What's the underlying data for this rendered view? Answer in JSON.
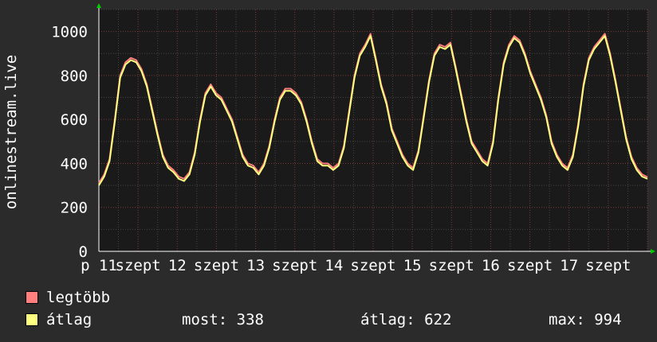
{
  "chart_data": {
    "type": "line",
    "ylabel": "onlinestream.live",
    "ylim": [
      0,
      1100
    ],
    "yticks": [
      0,
      200,
      400,
      600,
      800,
      1000
    ],
    "xlim": [
      0,
      7.0
    ],
    "x_tick_labels": [
      {
        "x": 0.0,
        "label": "p 11"
      },
      {
        "x": 0.5,
        "label": "szept"
      },
      {
        "x": 1.0,
        "label": "12"
      },
      {
        "x": 1.5,
        "label": "szept"
      },
      {
        "x": 2.0,
        "label": "13"
      },
      {
        "x": 2.5,
        "label": "szept"
      },
      {
        "x": 3.0,
        "label": "14"
      },
      {
        "x": 3.5,
        "label": "szept"
      },
      {
        "x": 4.0,
        "label": "15"
      },
      {
        "x": 4.5,
        "label": "szept"
      },
      {
        "x": 5.0,
        "label": "16"
      },
      {
        "x": 5.5,
        "label": "szept"
      },
      {
        "x": 6.0,
        "label": "17"
      },
      {
        "x": 6.5,
        "label": "szept"
      }
    ],
    "grid": true,
    "series": [
      {
        "name": "legtöbb",
        "color": "#ff7f7f",
        "values": [
          310,
          350,
          420,
          600,
          800,
          860,
          880,
          870,
          830,
          760,
          650,
          540,
          440,
          390,
          370,
          340,
          330,
          360,
          450,
          600,
          720,
          760,
          720,
          700,
          650,
          600,
          520,
          440,
          400,
          390,
          360,
          400,
          480,
          600,
          700,
          740,
          740,
          720,
          680,
          600,
          500,
          420,
          400,
          400,
          380,
          400,
          480,
          640,
          800,
          900,
          940,
          990,
          880,
          760,
          680,
          560,
          500,
          440,
          400,
          380,
          460,
          620,
          780,
          900,
          940,
          930,
          950,
          840,
          720,
          600,
          500,
          460,
          420,
          400,
          500,
          700,
          860,
          940,
          980,
          960,
          900,
          820,
          760,
          700,
          620,
          500,
          440,
          400,
          380,
          440,
          580,
          760,
          880,
          930,
          960,
          990,
          900,
          780,
          650,
          520,
          430,
          380,
          350,
          338
        ]
      },
      {
        "name": "átlag",
        "color": "#ffff80",
        "values": [
          300,
          340,
          410,
          590,
          790,
          850,
          870,
          860,
          820,
          750,
          640,
          530,
          430,
          380,
          360,
          330,
          320,
          350,
          440,
          590,
          710,
          750,
          710,
          690,
          640,
          590,
          510,
          430,
          390,
          380,
          350,
          390,
          470,
          590,
          690,
          730,
          730,
          710,
          670,
          590,
          490,
          410,
          390,
          390,
          370,
          390,
          470,
          630,
          790,
          890,
          930,
          980,
          870,
          750,
          670,
          550,
          490,
          430,
          390,
          370,
          450,
          610,
          770,
          890,
          930,
          920,
          940,
          830,
          710,
          590,
          490,
          450,
          410,
          390,
          490,
          690,
          850,
          930,
          970,
          950,
          890,
          810,
          750,
          690,
          610,
          490,
          430,
          390,
          370,
          430,
          570,
          750,
          870,
          920,
          950,
          980,
          890,
          770,
          640,
          510,
          420,
          370,
          340,
          330
        ]
      }
    ],
    "legend": [
      {
        "label": "legtöbb",
        "color": "#ff7f7f"
      },
      {
        "label": "átlag",
        "color": "#ffff80"
      }
    ],
    "stats": {
      "current": "most: 338",
      "average": "átlag: 622",
      "max": "max: 994"
    }
  }
}
